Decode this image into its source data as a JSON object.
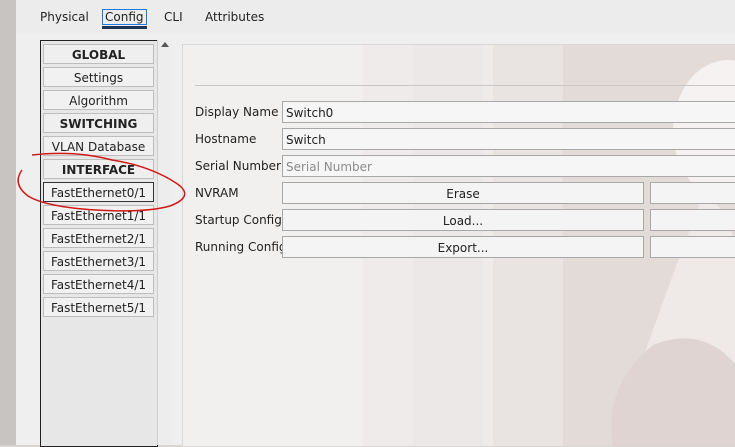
{
  "tabs": [
    "Physical",
    "Config",
    "CLI",
    "Attributes"
  ],
  "config_list": {
    "items": [
      {
        "label": "GLOBAL",
        "type": "header"
      },
      {
        "label": "Settings",
        "type": "item"
      },
      {
        "label": "Algorithm Settings",
        "type": "item"
      },
      {
        "label": "SWITCHING",
        "type": "header"
      },
      {
        "label": "VLAN Database",
        "type": "item"
      },
      {
        "label": "INTERFACE",
        "type": "header"
      },
      {
        "label": "FastEthernet0/1",
        "type": "item",
        "selected": true
      },
      {
        "label": "FastEthernet1/1",
        "type": "item"
      },
      {
        "label": "FastEthernet2/1",
        "type": "item"
      },
      {
        "label": "FastEthernet3/1",
        "type": "item"
      },
      {
        "label": "FastEthernet4/1",
        "type": "item"
      },
      {
        "label": "FastEthernet5/1",
        "type": "item"
      }
    ]
  },
  "form": {
    "display_name_label": "Display Name",
    "display_name_value": "Switch0",
    "hostname_label": "Hostname",
    "hostname_value": "Switch",
    "serial_label": "Serial Number",
    "serial_placeholder": "Serial Number",
    "nvram_label": "NVRAM",
    "erase_label": "Erase",
    "startup_label": "Startup Config",
    "load_label": "Load...",
    "running_label": "Running Config",
    "export_label": "Export..."
  },
  "annotation_color": "#d01818"
}
